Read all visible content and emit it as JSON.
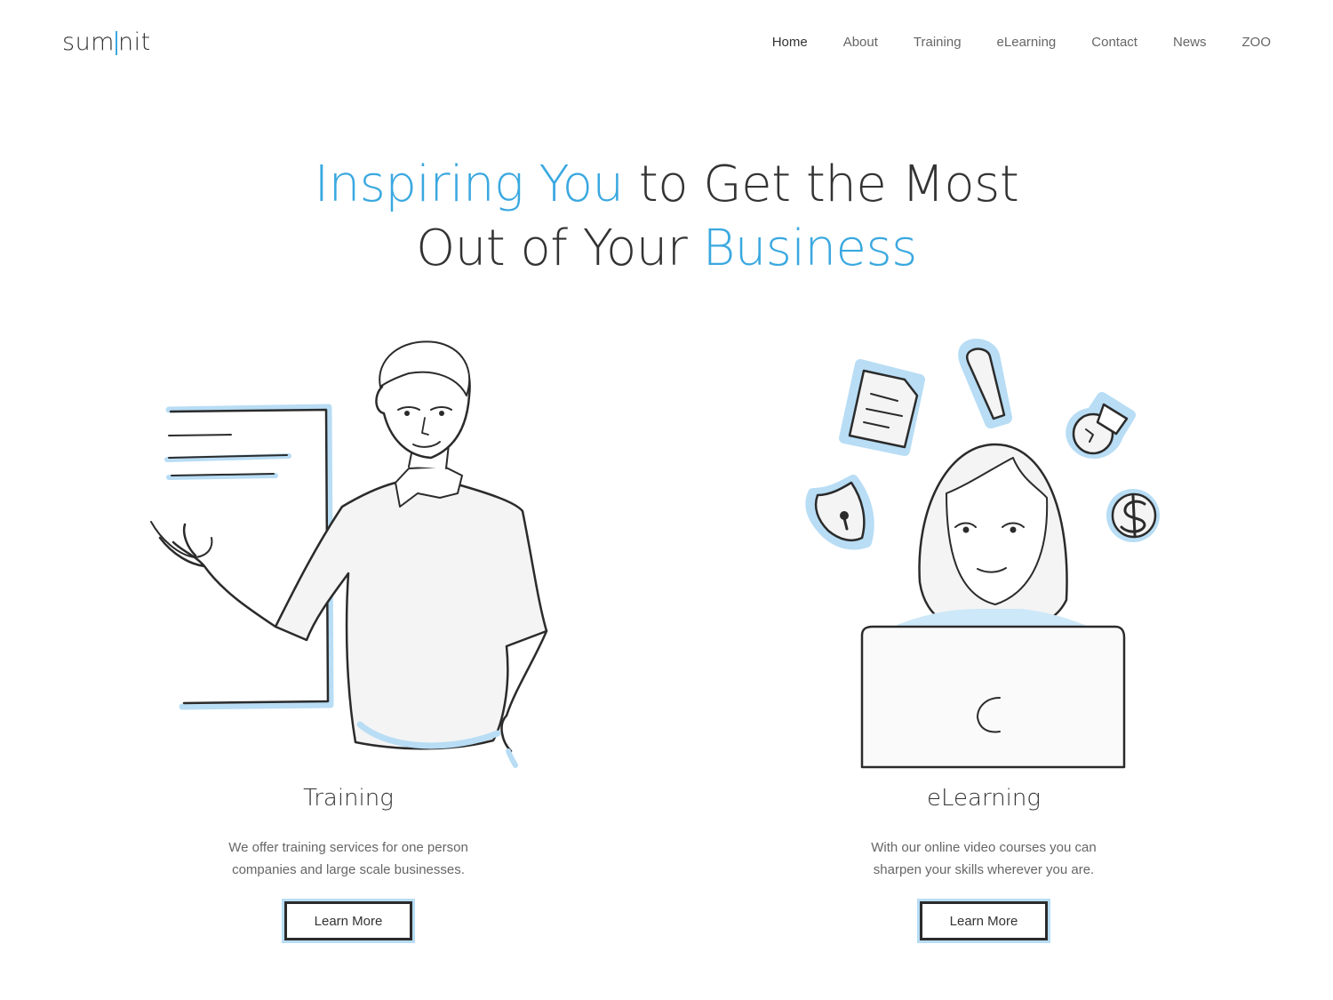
{
  "brand": {
    "logo_left": "sum",
    "logo_right": "nit"
  },
  "nav": {
    "items": [
      "Home",
      "About",
      "Training",
      "eLearning",
      "Contact",
      "News",
      "ZOO"
    ],
    "active": "Home"
  },
  "hero": {
    "line1_blue": "Inspiring You",
    "line1_rest": " to Get the Most",
    "line2_start": "Out of Your ",
    "line2_blue": "Business"
  },
  "cards": [
    {
      "title": "Training",
      "desc_line1": "We offer training services for one person",
      "desc_line2": "companies and large scale businesses.",
      "button": "Learn More"
    },
    {
      "title": "eLearning",
      "desc_line1": "With our online video courses you can",
      "desc_line2": "sharpen your skills wherever you are.",
      "button": "Learn More"
    }
  ],
  "colors": {
    "accent": "#3aa8e0",
    "accent_light": "#b8ddf5",
    "text": "#333333",
    "muted": "#666666"
  }
}
